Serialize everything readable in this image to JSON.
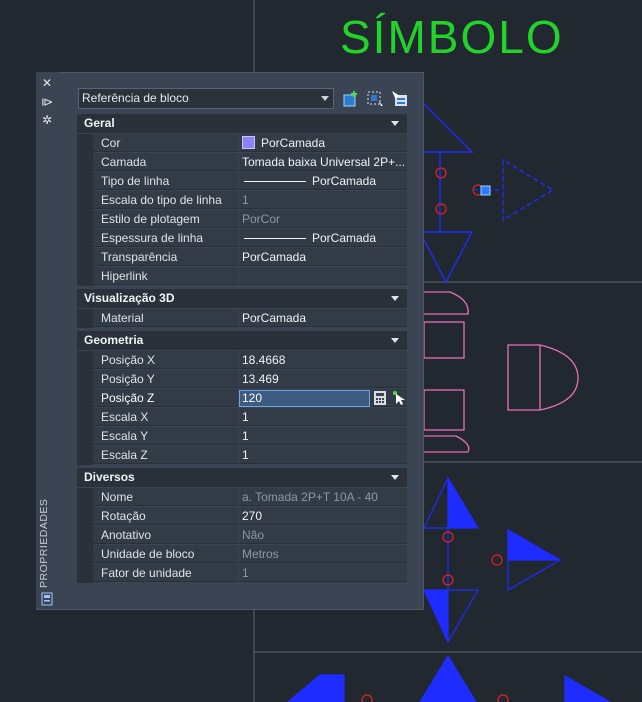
{
  "drawing": {
    "title": "SÍMBOLO",
    "colors": {
      "background": "#212830",
      "title": "#22d32a",
      "symbols": "#1f2cff",
      "outline_pink": "#e86fb8",
      "marker_red": "#e02424",
      "grid": "#5b6470"
    }
  },
  "palette": {
    "side_label": "PROPRIEDADES",
    "side_icons": [
      "close-icon",
      "auto-hide-icon",
      "settings-icon",
      "quick-properties-icon"
    ],
    "selector": {
      "value": "Referência de bloco"
    },
    "toolbar_icons": [
      "quick-select-icon",
      "select-objects-icon",
      "toggle-pickadd-icon"
    ],
    "sections": {
      "geral": {
        "title": "Geral",
        "rows": [
          {
            "name": "Cor",
            "value": "PorCamada"
          },
          {
            "name": "Camada",
            "value": "Tomada baixa Universal 2P+..."
          },
          {
            "name": "Tipo de linha",
            "value": "PorCamada"
          },
          {
            "name": "Escala do tipo de linha",
            "value": "1"
          },
          {
            "name": "Estilo de plotagem",
            "value": "PorCor"
          },
          {
            "name": "Espessura de linha",
            "value": "PorCamada"
          },
          {
            "name": "Transparência",
            "value": "PorCamada"
          },
          {
            "name": "Hiperlink",
            "value": ""
          }
        ]
      },
      "visualizacao": {
        "title": "Visualização 3D",
        "rows": [
          {
            "name": "Material",
            "value": "PorCamada"
          }
        ]
      },
      "geometria": {
        "title": "Geometria",
        "rows": [
          {
            "name": "Posição X",
            "value": "18.4668"
          },
          {
            "name": "Posição Y",
            "value": "13.469"
          },
          {
            "name": "Posição Z",
            "value": "120"
          },
          {
            "name": "Escala X",
            "value": "1"
          },
          {
            "name": "Escala Y",
            "value": "1"
          },
          {
            "name": "Escala Z",
            "value": "1"
          }
        ]
      },
      "diversos": {
        "title": "Diversos",
        "rows": [
          {
            "name": "Nome",
            "value": "a. Tomada 2P+T 10A - 40"
          },
          {
            "name": "Rotação",
            "value": "270"
          },
          {
            "name": "Anotativo",
            "value": "Não"
          },
          {
            "name": "Unidade de bloco",
            "value": "Metros"
          },
          {
            "name": "Fator de unidade",
            "value": "1"
          }
        ]
      }
    },
    "swatch_color": "#8a82f6",
    "input_color": "#3d5a80"
  }
}
